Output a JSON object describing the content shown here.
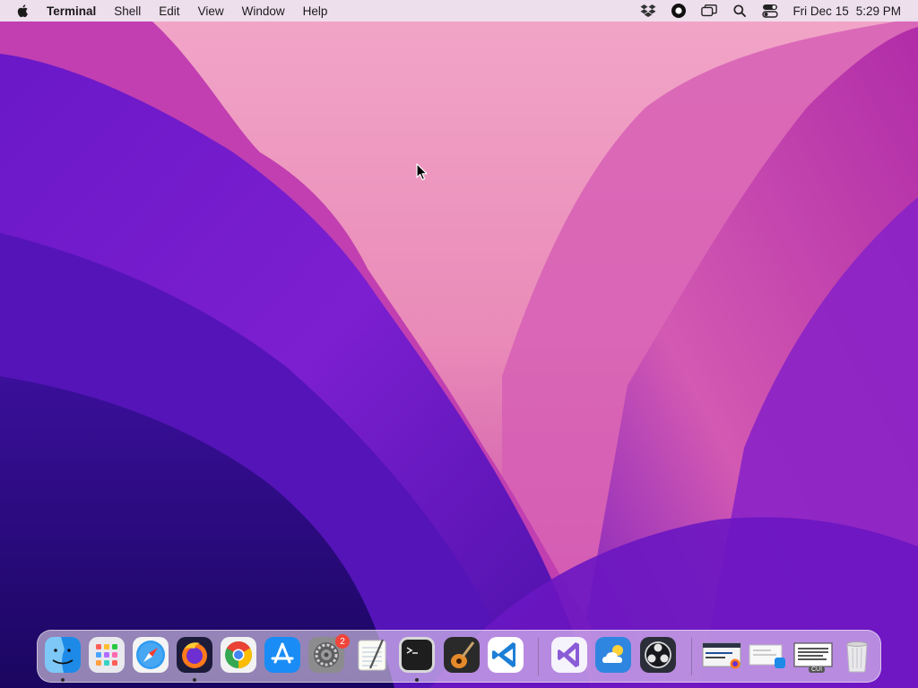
{
  "menubar": {
    "app_name": "Terminal",
    "menus": [
      "Shell",
      "Edit",
      "View",
      "Window",
      "Help"
    ],
    "status_icons": [
      "dropbox-icon",
      "screen-record-icon",
      "screen-mirror-icon",
      "search-icon",
      "control-center-icon"
    ],
    "clock": {
      "day": "Fri Dec 15",
      "time": "5:29 PM"
    }
  },
  "dock": {
    "apps": [
      {
        "name": "finder-app",
        "running": true
      },
      {
        "name": "launchpad-app",
        "running": false
      },
      {
        "name": "safari-app",
        "running": false
      },
      {
        "name": "firefox-app",
        "running": true
      },
      {
        "name": "chrome-app",
        "running": false
      },
      {
        "name": "app-store-app",
        "running": false
      },
      {
        "name": "system-preferences-app",
        "running": false,
        "badge": "2"
      },
      {
        "name": "textedit-app",
        "running": false
      },
      {
        "name": "terminal-app",
        "running": true
      },
      {
        "name": "garageband-app",
        "running": false
      },
      {
        "name": "vscode-app",
        "running": false
      },
      {
        "name": "visual-studio-app",
        "running": false
      },
      {
        "name": "weather-app",
        "running": false
      },
      {
        "name": "obs-app",
        "running": false
      }
    ],
    "recent_label": "CUI",
    "colors": {
      "accent_red": "#f0453a",
      "terminal_bg": "#1e1e1e",
      "vscode_blue": "#1c7ed6"
    }
  }
}
